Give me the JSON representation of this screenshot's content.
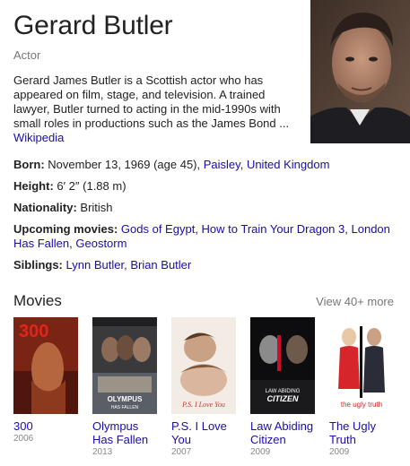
{
  "entity": {
    "name": "Gerard Butler",
    "type": "Actor",
    "description": "Gerard James Butler is a Scottish actor who has appeared on film, stage, and television. A trained lawyer, Butler turned to acting in the mid-1990s with small roles in productions such as the James Bond ...",
    "source_link": "Wikipedia"
  },
  "facts": {
    "born": {
      "label": "Born:",
      "text": "November 13, 1969 (age 45),",
      "link1": "Paisley",
      "sep": ",",
      "link2": "United Kingdom"
    },
    "height": {
      "label": "Height:",
      "value": "6′ 2″ (1.88 m)"
    },
    "nationality": {
      "label": "Nationality:",
      "value": "British"
    },
    "upcoming": {
      "label": "Upcoming movies:",
      "items": [
        "Gods of Egypt",
        "How to Train Your Dragon 3",
        "London Has Fallen",
        "Geostorm"
      ],
      "sep": ","
    },
    "siblings": {
      "label": "Siblings:",
      "items": [
        "Lynn Butler",
        "Brian Butler"
      ],
      "sep": ","
    }
  },
  "movies": {
    "heading": "Movies",
    "view_more": "View 40+ more",
    "items": [
      {
        "title": "300",
        "year": "2006",
        "poster_text": "300"
      },
      {
        "title": "Olympus Has Fallen",
        "year": "2013",
        "poster_text": "OLYMPUS HAS FALLEN"
      },
      {
        "title": "P.S. I Love You",
        "year": "2007",
        "poster_text": "P.S. I Love You"
      },
      {
        "title": "Law Abiding Citizen",
        "year": "2009",
        "poster_text": "LAW ABIDING CITIZEN"
      },
      {
        "title": "The Ugly Truth",
        "year": "2009",
        "poster_text": "the ugly truth"
      }
    ]
  }
}
